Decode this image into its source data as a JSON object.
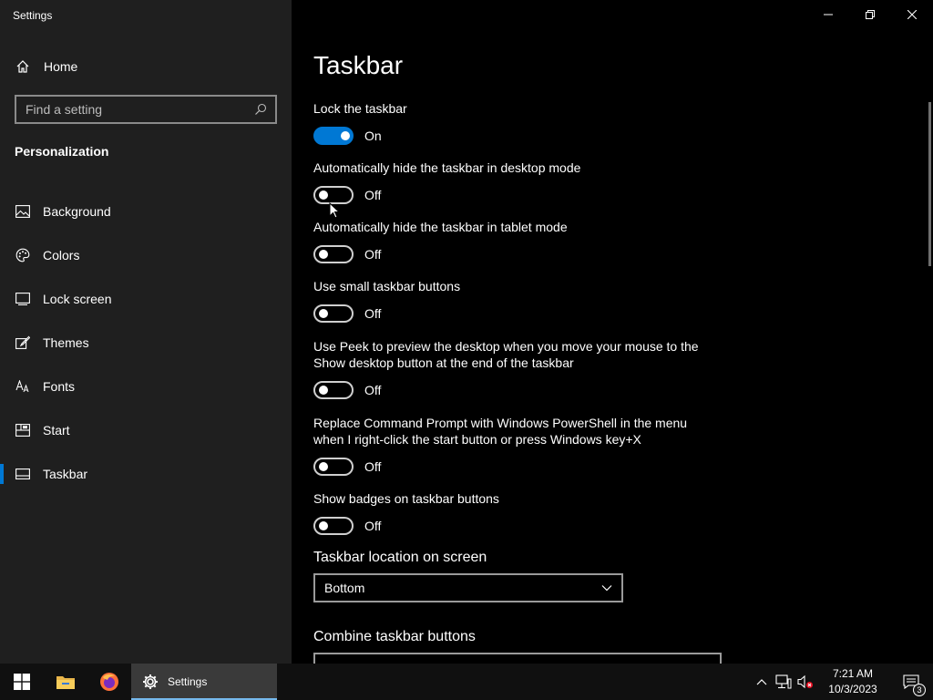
{
  "window": {
    "title": "Settings"
  },
  "sidebar": {
    "home_label": "Home",
    "search_placeholder": "Find a setting",
    "section_title": "Personalization",
    "items": [
      {
        "label": "Background",
        "icon": "image-icon"
      },
      {
        "label": "Colors",
        "icon": "palette-icon"
      },
      {
        "label": "Lock screen",
        "icon": "lock-screen-icon"
      },
      {
        "label": "Themes",
        "icon": "brush-icon"
      },
      {
        "label": "Fonts",
        "icon": "font-icon"
      },
      {
        "label": "Start",
        "icon": "start-icon"
      },
      {
        "label": "Taskbar",
        "icon": "taskbar-icon",
        "active": true
      }
    ]
  },
  "main": {
    "title": "Taskbar",
    "settings": [
      {
        "label": "Lock the taskbar",
        "state": "On",
        "on": true
      },
      {
        "label": "Automatically hide the taskbar in desktop mode",
        "state": "Off",
        "on": false
      },
      {
        "label": "Automatically hide the taskbar in tablet mode",
        "state": "Off",
        "on": false
      },
      {
        "label": "Use small taskbar buttons",
        "state": "Off",
        "on": false
      },
      {
        "label": "Use Peek to preview the desktop when you move your mouse to the Show desktop button at the end of the taskbar",
        "state": "Off",
        "on": false
      },
      {
        "label": "Replace Command Prompt with Windows PowerShell in the menu when I right-click the start button or press Windows key+X",
        "state": "Off",
        "on": false
      },
      {
        "label": "Show badges on taskbar buttons",
        "state": "Off",
        "on": false
      }
    ],
    "location_label": "Taskbar location on screen",
    "location_value": "Bottom",
    "combine_label": "Combine taskbar buttons"
  },
  "taskbar": {
    "active_app": "Settings",
    "time": "7:21 AM",
    "date": "10/3/2023",
    "notification_count": "3"
  },
  "colors": {
    "accent": "#0078d4",
    "sidebar_bg": "#1f1f1f",
    "main_bg": "#000000"
  }
}
